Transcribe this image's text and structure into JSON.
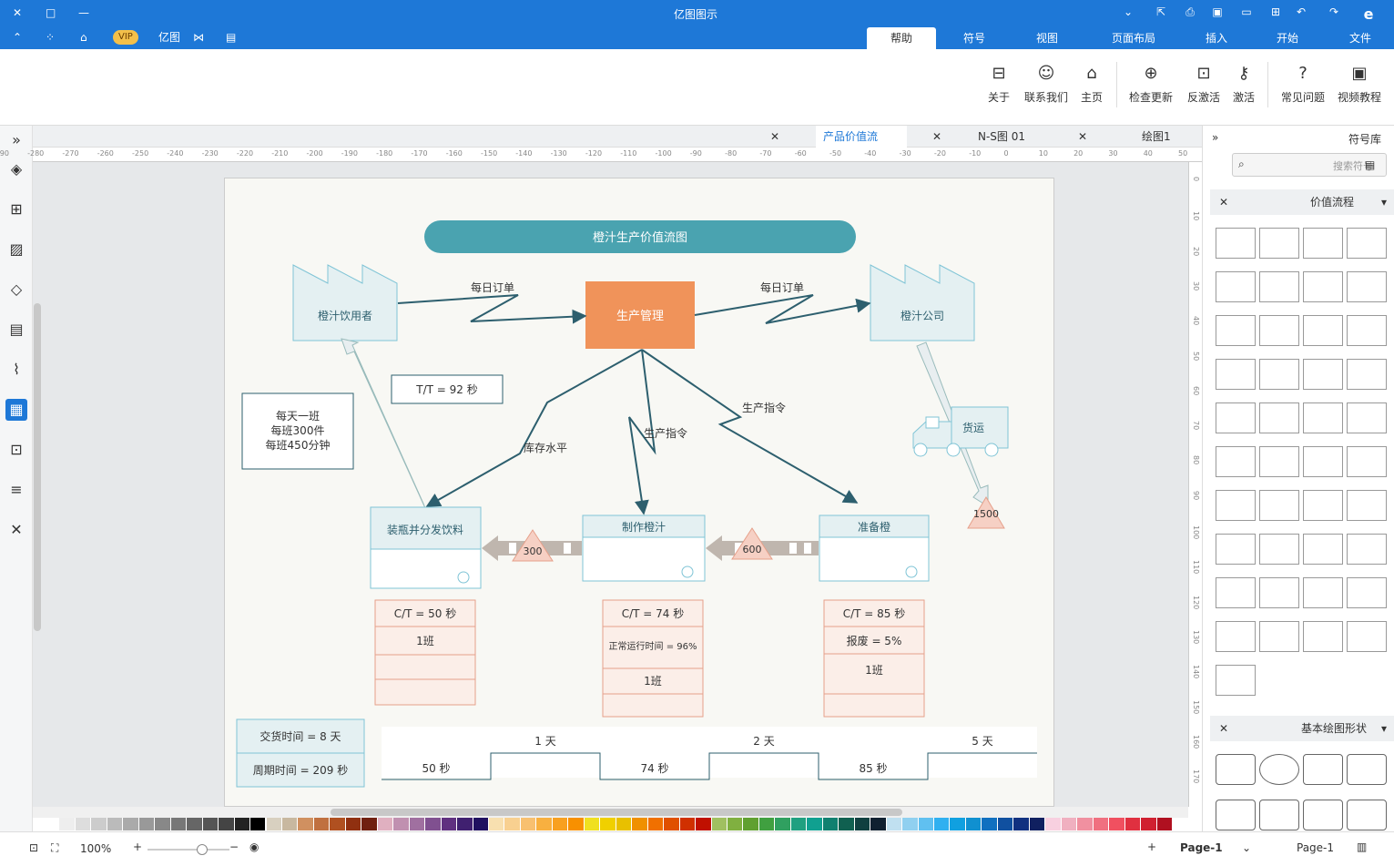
{
  "window": {
    "title": "亿图图示"
  },
  "titlebar": {
    "vip_label": "VIP",
    "account_label": "亿图"
  },
  "menu": {
    "tabs": [
      "文件",
      "开始",
      "插入",
      "页面布局",
      "视图",
      "符号",
      "帮助"
    ],
    "active": "帮助"
  },
  "ribbon": {
    "buttons": [
      "视频教程",
      "常见问题",
      "激活",
      "反激活",
      "检查更新",
      "主页",
      "联系我们",
      "关于"
    ]
  },
  "doc_tabs": [
    {
      "label": "绘图1"
    },
    {
      "label": "N-S图 01"
    },
    {
      "label": "产品价值流"
    }
  ],
  "ruler": {
    "h_ticks": [
      "50",
      "40",
      "30",
      "20",
      "10",
      "0",
      "-10",
      "-20",
      "-30",
      "-40",
      "-50",
      "-60",
      "-70",
      "-80",
      "-90",
      "-100",
      "-110",
      "-120",
      "-130",
      "-140",
      "-150",
      "-160",
      "-170",
      "-180",
      "-190",
      "-200",
      "-210",
      "-220",
      "-230",
      "-240",
      "-250",
      "-260",
      "-270",
      "-280",
      "-290"
    ],
    "v_ticks": [
      "0",
      "10",
      "20",
      "30",
      "40",
      "50",
      "60",
      "70",
      "80",
      "90",
      "100",
      "110",
      "120",
      "130",
      "140",
      "150",
      "160",
      "170"
    ]
  },
  "diagram": {
    "title": "橙汁生产价值流图",
    "supplier": "橙汁公司",
    "customer": "橙汁饮用者",
    "control": "生产管理",
    "order_left": "每日订单",
    "order_right": "每日订单",
    "instruction1": "生产指令",
    "instruction2": "生产指令",
    "instruction3": "库存水平",
    "truck": "货运",
    "tt": "T/T = 92 秒",
    "shift_info": [
      "每天一班",
      "每班300件",
      "每班450分钟"
    ],
    "inv_supplier": "1500",
    "inv_1": "600",
    "inv_2": "300",
    "processes": [
      {
        "name": "准备橙",
        "rows": [
          "C/T = 85 秒",
          "报废 = 5%",
          "1班",
          ""
        ]
      },
      {
        "name": "制作橙汁",
        "rows": [
          "C/T = 74 秒",
          "正常运行时间 = 96%",
          "1班",
          ""
        ]
      },
      {
        "name": "装瓶并分发饮料",
        "rows": [
          "C/T = 50 秒",
          "1班",
          "",
          ""
        ]
      }
    ],
    "timeline_days": [
      "5 天",
      "2 天",
      "1 天"
    ],
    "timeline_secs": [
      "85 秒",
      "74 秒",
      "50 秒"
    ],
    "lead_time": "交货时间 = 8 天",
    "cycle_time": "周期时间 = 209 秒"
  },
  "right_panel": {
    "title": "符号库",
    "search_placeholder": "搜索符号",
    "section1": "价值流程",
    "section2": "基本绘图形状"
  },
  "status": {
    "page_label": "Page-1",
    "page_tab": "Page-1",
    "zoom": "100%"
  },
  "colors": {
    "accent": "#1e78d7",
    "teal": "#4aa3b0",
    "orange": "#f0935a",
    "process_border": "#7fc4d6"
  }
}
